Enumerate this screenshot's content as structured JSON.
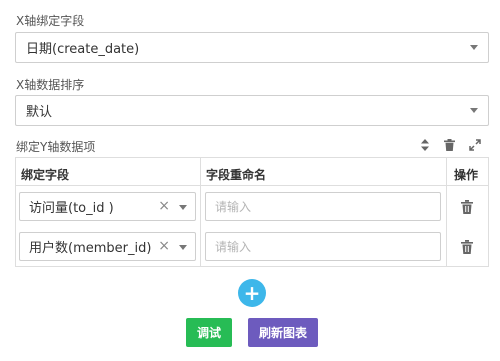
{
  "x_field": {
    "label": "X轴绑定字段",
    "value": "日期(create_date)"
  },
  "x_sort": {
    "label": "X轴数据排序",
    "value": "默认"
  },
  "y_items": {
    "label": "绑定Y轴数据项",
    "columns": [
      "绑定字段",
      "字段重命名",
      "操作"
    ],
    "rows": [
      {
        "field": "访问量(to_id )",
        "rename_placeholder": "请输入"
      },
      {
        "field": "用户数(member_id)",
        "rename_placeholder": "请输入"
      }
    ]
  },
  "buttons": {
    "debug": "调试",
    "refresh": "刷新图表"
  },
  "icons": {
    "add": "plus-icon",
    "remove": "close-icon",
    "delete": "trash-icon",
    "sort": "sort-icon",
    "expand": "expand-icon"
  },
  "colors": {
    "add_button": "#3db7ea",
    "debug_button": "#27bc55",
    "refresh_button": "#6d5bbe"
  }
}
